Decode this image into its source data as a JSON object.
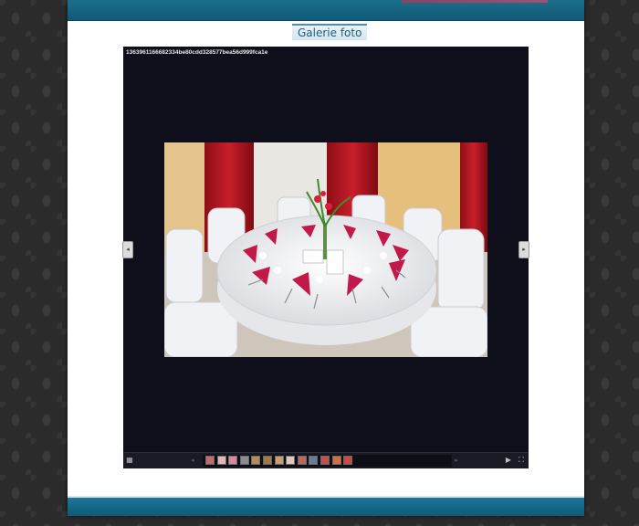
{
  "gallery": {
    "title": "Galerie foto",
    "file_name": "1363961166682334be80cdd328577bea56d999fca1e",
    "image_alt": "Banquet table setting with red napkins",
    "nav": {
      "prev_icon": "chevron-left-icon",
      "next_icon": "chevron-right-icon",
      "prev_glyph": "◂",
      "next_glyph": "▸"
    },
    "toolbar": {
      "grid_icon": "grid-icon",
      "play_icon": "play-icon",
      "fullscreen_icon": "fullscreen-icon",
      "grid_glyph": "▦",
      "play_glyph": "▶",
      "fullscreen_glyph": "⛶"
    },
    "thumbnail_colors": [
      "#c46a6a",
      "#e0b6b6",
      "#d88a9a",
      "#8c8c8c",
      "#b48c5a",
      "#a07850",
      "#c8a070",
      "#e0c8c0",
      "#b86a5a",
      "#6a7a9a",
      "#c05050",
      "#d07040",
      "#c84a40"
    ]
  },
  "colors": {
    "frame_bar": "#0f5a78",
    "title_text": "#1d5f83",
    "gallery_bg": "#0e0f1a"
  }
}
